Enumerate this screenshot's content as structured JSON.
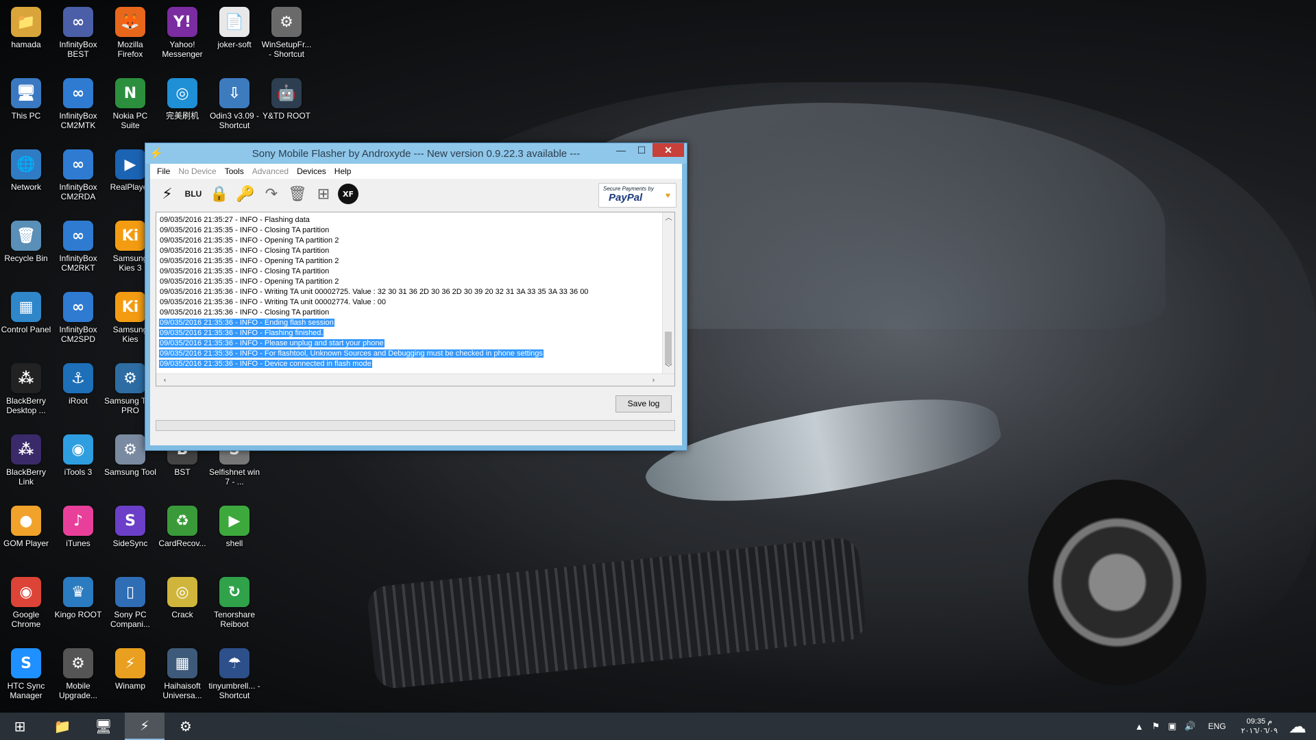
{
  "desktop": {
    "icons": [
      {
        "label": "hamada",
        "glyph": "📁",
        "color": "#d9a53a",
        "col": 0,
        "row": 0
      },
      {
        "label": "InfinityBox BEST",
        "glyph": "∞",
        "color": "#4b5fa8",
        "col": 1,
        "row": 0
      },
      {
        "label": "Mozilla Firefox",
        "glyph": "🦊",
        "color": "#e8671b",
        "col": 2,
        "row": 0
      },
      {
        "label": "Yahoo! Messenger",
        "glyph": "Y!",
        "color": "#7a2ca0",
        "col": 3,
        "row": 0
      },
      {
        "label": "joker-soft",
        "glyph": "📄",
        "color": "#e8e8e8",
        "col": 4,
        "row": 0
      },
      {
        "label": "WinSetupFr... - Shortcut",
        "glyph": "⚙",
        "color": "#6a6a6a",
        "col": 5,
        "row": 0
      },
      {
        "label": "This PC",
        "glyph": "🖥",
        "color": "#3a78c2",
        "col": 0,
        "row": 1
      },
      {
        "label": "InfinityBox CM2MTK",
        "glyph": "∞",
        "color": "#2e7bd1",
        "col": 1,
        "row": 1
      },
      {
        "label": "Nokia PC Suite",
        "glyph": "N",
        "color": "#2b8f3e",
        "col": 2,
        "row": 1
      },
      {
        "label": "完美刷机",
        "glyph": "◎",
        "color": "#1f8fd6",
        "col": 3,
        "row": 1
      },
      {
        "label": "Odin3 v3.09 - Shortcut",
        "glyph": "⇩",
        "color": "#3d7bbf",
        "col": 4,
        "row": 1
      },
      {
        "label": "Y&TD ROOT",
        "glyph": "🤖",
        "color": "#2c3e50",
        "col": 5,
        "row": 1
      },
      {
        "label": "Network",
        "glyph": "🌐",
        "color": "#2f7cc4",
        "col": 0,
        "row": 2
      },
      {
        "label": "InfinityBox CM2RDA",
        "glyph": "∞",
        "color": "#2e7bd1",
        "col": 1,
        "row": 2
      },
      {
        "label": "RealPlayer",
        "glyph": "▶",
        "color": "#1b63b3",
        "col": 2,
        "row": 2
      },
      {
        "label": "Recycle Bin",
        "glyph": "🗑",
        "color": "#5a8fb8",
        "col": 0,
        "row": 3
      },
      {
        "label": "InfinityBox CM2RKT",
        "glyph": "∞",
        "color": "#2e7bd1",
        "col": 1,
        "row": 3
      },
      {
        "label": "Samsung Kies 3",
        "glyph": "Ki",
        "color": "#f39c12",
        "col": 2,
        "row": 3
      },
      {
        "label": "Control Panel",
        "glyph": "▦",
        "color": "#2f86c9",
        "col": 0,
        "row": 4
      },
      {
        "label": "InfinityBox CM2SPD",
        "glyph": "∞",
        "color": "#2e7bd1",
        "col": 1,
        "row": 4
      },
      {
        "label": "Samsung Kies",
        "glyph": "Ki",
        "color": "#f39c12",
        "col": 2,
        "row": 4
      },
      {
        "label": "BlackBerry Desktop ...",
        "glyph": "⁂",
        "color": "#222222",
        "col": 0,
        "row": 5
      },
      {
        "label": "iRoot",
        "glyph": "⚓",
        "color": "#1d6fb8",
        "col": 1,
        "row": 5
      },
      {
        "label": "Samsung Tool PRO",
        "glyph": "⚙",
        "color": "#2d6da3",
        "col": 2,
        "row": 5
      },
      {
        "label": "BlackBerry Link",
        "glyph": "⁂",
        "color": "#3a2a6a",
        "col": 0,
        "row": 6
      },
      {
        "label": "iTools 3",
        "glyph": "◉",
        "color": "#2f9ee0",
        "col": 1,
        "row": 6
      },
      {
        "label": "Samsung Tool",
        "glyph": "⚙",
        "color": "#7a8aa0",
        "col": 2,
        "row": 6
      },
      {
        "label": "BST",
        "glyph": "B",
        "color": "#444444",
        "col": 3,
        "row": 6
      },
      {
        "label": "Selfishnet win 7 - ...",
        "glyph": "S",
        "color": "#777777",
        "col": 4,
        "row": 6
      },
      {
        "label": "GOM Player",
        "glyph": "●",
        "color": "#f0a22a",
        "col": 0,
        "row": 7
      },
      {
        "label": "iTunes",
        "glyph": "♪",
        "color": "#e8409a",
        "col": 1,
        "row": 7
      },
      {
        "label": "SideSync",
        "glyph": "S",
        "color": "#6b3fc7",
        "col": 2,
        "row": 7
      },
      {
        "label": "CardRecov...",
        "glyph": "♻",
        "color": "#3a9a3a",
        "col": 3,
        "row": 7
      },
      {
        "label": "shell",
        "glyph": "▶",
        "color": "#3da93d",
        "col": 4,
        "row": 7
      },
      {
        "label": "Google Chrome",
        "glyph": "◉",
        "color": "#db4437",
        "col": 0,
        "row": 8
      },
      {
        "label": "Kingo ROOT",
        "glyph": "♛",
        "color": "#2a7bc0",
        "col": 1,
        "row": 8
      },
      {
        "label": "Sony PC Compani...",
        "glyph": "▯",
        "color": "#2f6db5",
        "col": 2,
        "row": 8
      },
      {
        "label": "Crack",
        "glyph": "◎",
        "color": "#cfb53b",
        "col": 3,
        "row": 8
      },
      {
        "label": "Tenorshare Reiboot",
        "glyph": "↻",
        "color": "#2fa24a",
        "col": 4,
        "row": 8
      },
      {
        "label": "HTC Sync Manager",
        "glyph": "S",
        "color": "#1e90ff",
        "col": 0,
        "row": 9
      },
      {
        "label": "Mobile Upgrade...",
        "glyph": "⚙",
        "color": "#555555",
        "col": 1,
        "row": 9
      },
      {
        "label": "Winamp",
        "glyph": "⚡",
        "color": "#e9a020",
        "col": 2,
        "row": 9
      },
      {
        "label": "Haihaisoft Universa...",
        "glyph": "▦",
        "color": "#3e5a7a",
        "col": 3,
        "row": 9
      },
      {
        "label": "tinyumbrell... - Shortcut",
        "glyph": "☂",
        "color": "#2d4f8a",
        "col": 4,
        "row": 9
      }
    ]
  },
  "window": {
    "title": "Sony Mobile Flasher by Androxyde     --- New version 0.9.22.3 available ---",
    "app_icon": "⚡",
    "controls": {
      "minimize": "—",
      "maximize": "☐",
      "close": "✕"
    },
    "menu": [
      {
        "label": "File",
        "enabled": true
      },
      {
        "label": "No Device",
        "enabled": false
      },
      {
        "label": "Tools",
        "enabled": true
      },
      {
        "label": "Advanced",
        "enabled": false
      },
      {
        "label": "Devices",
        "enabled": true
      },
      {
        "label": "Help",
        "enabled": true
      }
    ],
    "toolbar": {
      "blu_label": "BLU",
      "xperia_label": "XF",
      "paypal_top": "Secure Payments by",
      "paypal_main": "PayPal",
      "paypal_heart": "♥"
    },
    "log_lines": [
      {
        "text": "09/035/2016 21:35:27 - INFO  -     Flashing data",
        "selected": false
      },
      {
        "text": "09/035/2016 21:35:35 - INFO  - Closing TA partition",
        "selected": false
      },
      {
        "text": "09/035/2016 21:35:35 - INFO  - Opening TA partition 2",
        "selected": false
      },
      {
        "text": "09/035/2016 21:35:35 - INFO  - Closing TA partition",
        "selected": false
      },
      {
        "text": "09/035/2016 21:35:35 - INFO  - Opening TA partition 2",
        "selected": false
      },
      {
        "text": "09/035/2016 21:35:35 - INFO  - Closing TA partition",
        "selected": false
      },
      {
        "text": "09/035/2016 21:35:35 - INFO  - Opening TA partition 2",
        "selected": false
      },
      {
        "text": "09/035/2016 21:35:36 - INFO  - Writing TA unit 00002725. Value : 32 30 31 36 2D 30 36 2D 30 39 20 32 31 3A 33 35 3A 33 36 00",
        "selected": false
      },
      {
        "text": "09/035/2016 21:35:36 - INFO  - Writing TA unit 00002774. Value : 00",
        "selected": false
      },
      {
        "text": "09/035/2016 21:35:36 - INFO  - Closing TA partition",
        "selected": false
      },
      {
        "text": "09/035/2016 21:35:36 - INFO  - Ending flash session",
        "selected": true
      },
      {
        "text": "09/035/2016 21:35:36 - INFO  - Flashing finished.",
        "selected": true
      },
      {
        "text": "09/035/2016 21:35:36 - INFO  - Please unplug and start your phone",
        "selected": true
      },
      {
        "text": "09/035/2016 21:35:36 - INFO  - For flashtool, Unknown Sources and Debugging must be checked in phone settings",
        "selected": true
      },
      {
        "text": "09/035/2016 21:35:36 - INFO  - Device connected in flash mode",
        "selected": true
      }
    ],
    "save_log_label": "Save log",
    "progress": 0
  },
  "taskbar": {
    "items": [
      {
        "name": "start-button",
        "glyph": "⊞",
        "active": false
      },
      {
        "name": "file-explorer",
        "glyph": "📁",
        "active": false
      },
      {
        "name": "desktop-app",
        "glyph": "🖥",
        "active": false
      },
      {
        "name": "flashtool",
        "glyph": "⚡",
        "active": true
      },
      {
        "name": "settings-app",
        "glyph": "⚙",
        "active": false
      }
    ],
    "tray": {
      "up_arrow": "▲",
      "flag": "⚑",
      "network": "▣",
      "volume": "🔊",
      "language": "ENG",
      "time": "09:35 م",
      "date": "٢٠١٦/٠٦/٠٩",
      "weather": "☁"
    }
  }
}
